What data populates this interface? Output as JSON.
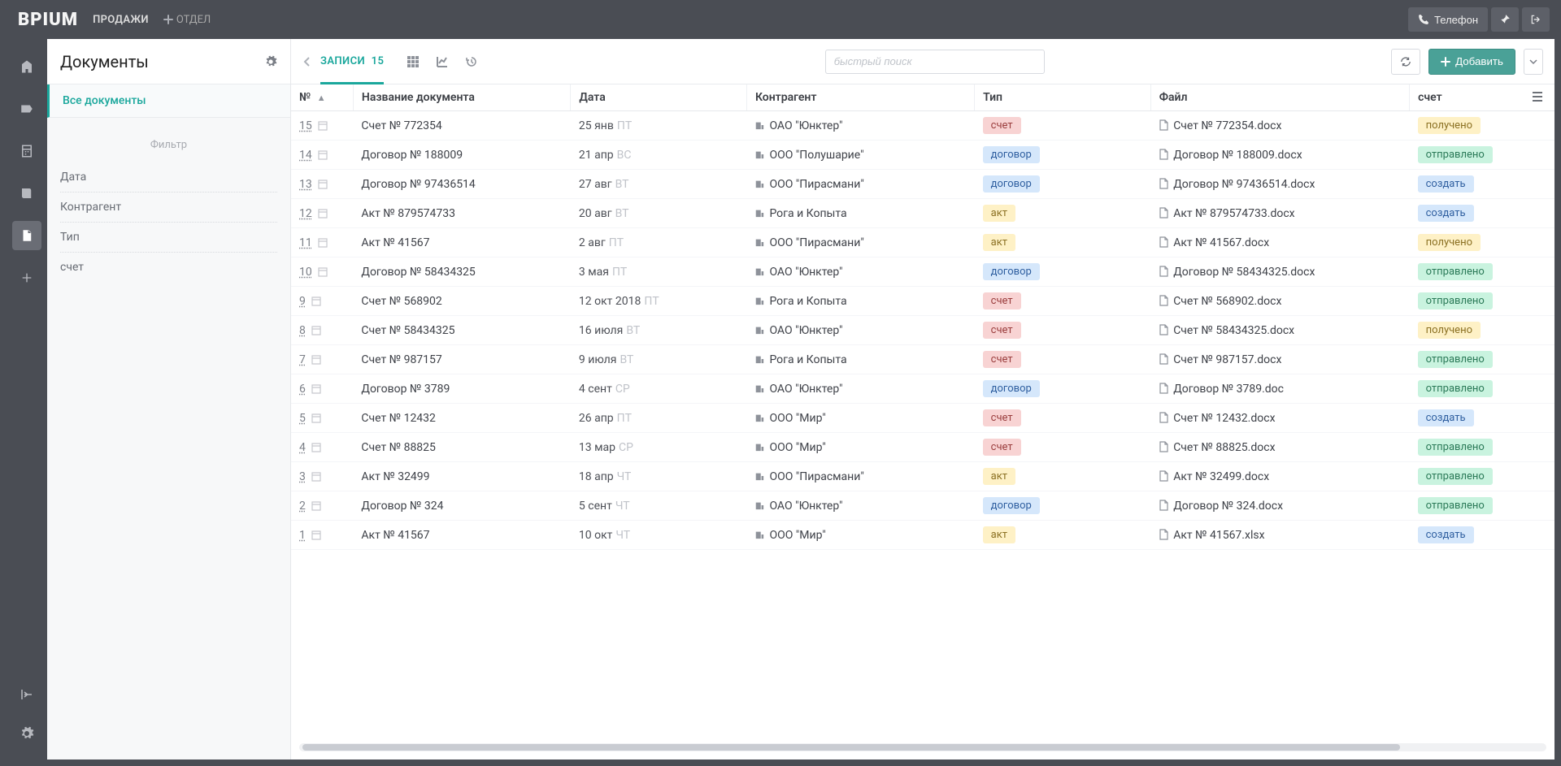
{
  "logo": "BPIUM",
  "top": {
    "link1": "ПРОДАЖИ",
    "add_dept": "ОТДЕЛ",
    "phone": "Телефон"
  },
  "lp": {
    "title": "Документы",
    "current": "Все документы",
    "filter_title": "Фильтр",
    "filters": [
      "Дата",
      "Контрагент",
      "Тип",
      "счет"
    ]
  },
  "toolbar": {
    "records": "ЗАПИСИ",
    "records_count": "15",
    "search_ph": "быстрый поиск",
    "add_btn": "Добавить"
  },
  "columns": {
    "num": "№",
    "name": "Название документа",
    "date": "Дата",
    "contr": "Контрагент",
    "type": "Тип",
    "file": "Файл",
    "status": "счет"
  },
  "type_colors": {
    "счет": "red",
    "договор": "blue",
    "акт": "yellow"
  },
  "status_colors": {
    "получено": "yellow",
    "отправлено": "green",
    "создать": "blue"
  },
  "rows": [
    {
      "num": "15",
      "name": "Счет № 772354",
      "date": "25 янв",
      "wd": "ПТ",
      "contr": "ОАО \"Юнктер\"",
      "type": "счет",
      "file": "Счет № 772354.docx",
      "status": "получено"
    },
    {
      "num": "14",
      "name": "Договор № 188009",
      "date": "21 апр",
      "wd": "ВС",
      "contr": "ООО \"Полушарие\"",
      "type": "договор",
      "file": "Договор № 188009.docx",
      "status": "отправлено"
    },
    {
      "num": "13",
      "name": "Договор № 97436514",
      "date": "27 авг",
      "wd": "ВТ",
      "contr": "ООО \"Пирасмани\"",
      "type": "договор",
      "file": "Договор № 97436514.docx",
      "status": "создать"
    },
    {
      "num": "12",
      "name": "Акт № 879574733",
      "date": "20 авг",
      "wd": "ВТ",
      "contr": "Рога и Копыта",
      "type": "акт",
      "file": "Акт № 879574733.docx",
      "status": "создать"
    },
    {
      "num": "11",
      "name": "Акт № 41567",
      "date": "2 авг",
      "wd": "ПТ",
      "contr": "ООО \"Пирасмани\"",
      "type": "акт",
      "file": "Акт № 41567.docx",
      "status": "получено"
    },
    {
      "num": "10",
      "name": "Договор № 58434325",
      "date": "3 мая",
      "wd": "ПТ",
      "contr": "ОАО \"Юнктер\"",
      "type": "договор",
      "file": "Договор № 58434325.docx",
      "status": "отправлено"
    },
    {
      "num": "9",
      "name": "Счет № 568902",
      "date": "12 окт 2018",
      "wd": "ПТ",
      "contr": "Рога и Копыта",
      "type": "счет",
      "file": "Счет № 568902.docx",
      "status": "отправлено"
    },
    {
      "num": "8",
      "name": "Счет № 58434325",
      "date": "16 июля",
      "wd": "ВТ",
      "contr": "ОАО \"Юнктер\"",
      "type": "счет",
      "file": "Счет № 58434325.docx",
      "status": "получено"
    },
    {
      "num": "7",
      "name": "Счет № 987157",
      "date": "9 июля",
      "wd": "ВТ",
      "contr": "Рога и Копыта",
      "type": "счет",
      "file": "Счет № 987157.docx",
      "status": "отправлено"
    },
    {
      "num": "6",
      "name": "Договор № 3789",
      "date": "4 сент",
      "wd": "СР",
      "contr": "ОАО \"Юнктер\"",
      "type": "договор",
      "file": "Договор № 3789.doc",
      "status": "отправлено"
    },
    {
      "num": "5",
      "name": "Счет № 12432",
      "date": "26 апр",
      "wd": "ПТ",
      "contr": "ООО \"Мир\"",
      "type": "счет",
      "file": "Счет № 12432.docx",
      "status": "создать"
    },
    {
      "num": "4",
      "name": "Счет № 88825",
      "date": "13 мар",
      "wd": "СР",
      "contr": "ООО \"Мир\"",
      "type": "счет",
      "file": "Счет № 88825.docx",
      "status": "отправлено"
    },
    {
      "num": "3",
      "name": "Акт № 32499",
      "date": "18 апр",
      "wd": "ЧТ",
      "contr": "ООО \"Пирасмани\"",
      "type": "акт",
      "file": "Акт № 32499.docx",
      "status": "отправлено"
    },
    {
      "num": "2",
      "name": "Договор № 324",
      "date": "5 сент",
      "wd": "ЧТ",
      "contr": "ОАО \"Юнктер\"",
      "type": "договор",
      "file": "Договор № 324.docx",
      "status": "отправлено"
    },
    {
      "num": "1",
      "name": "Акт № 41567",
      "date": "10 окт",
      "wd": "ЧТ",
      "contr": "ООО \"Мир\"",
      "type": "акт",
      "file": "Акт № 41567.xlsx",
      "status": "создать"
    }
  ]
}
